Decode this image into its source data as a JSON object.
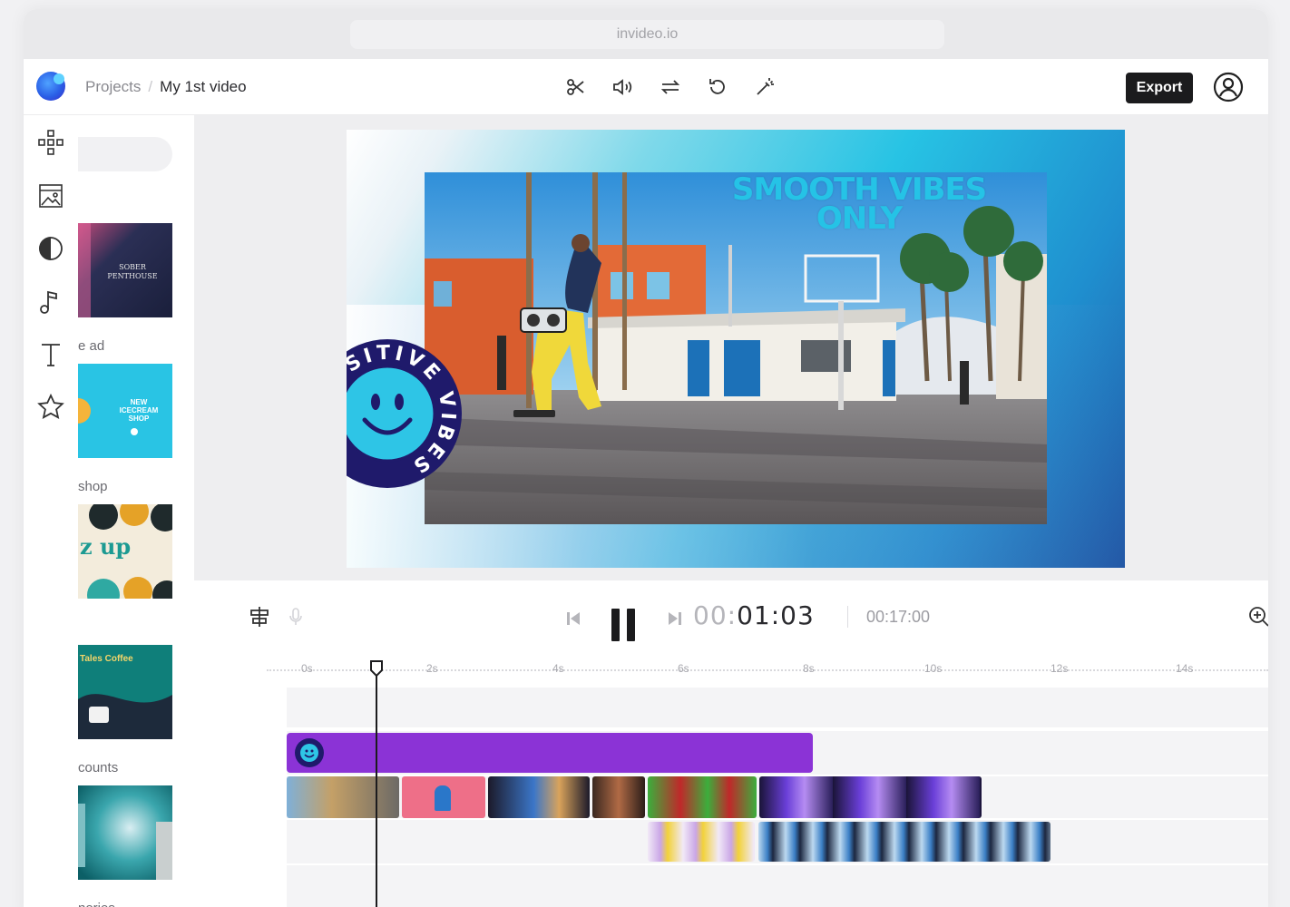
{
  "browser": {
    "url": "invideo.io"
  },
  "breadcrumb": {
    "projects": "Projects",
    "separator": "/",
    "current": "My 1st video"
  },
  "toolbar": {
    "icons": [
      "scissors-icon",
      "volume-icon",
      "swap-icon",
      "rotate-icon",
      "magic-wand-icon"
    ],
    "export_label": "Export"
  },
  "sidebar": {
    "icons": [
      "layout-icon",
      "media-icon",
      "stickers-icon",
      "music-icon",
      "text-icon",
      "star-icon"
    ]
  },
  "templates": [
    {
      "label": "e ad",
      "title": "SOBER PENTHOUSE"
    },
    {
      "label": "shop",
      "title": "NEW ICECREAM SHOP"
    },
    {
      "label": "",
      "title": "z up"
    },
    {
      "label": "counts",
      "title": "Tales Coffee"
    },
    {
      "label": "nories",
      "title": ""
    }
  ],
  "canvas": {
    "headline_line1": "SMOOTH VIBES",
    "headline_line2": "ONLY",
    "sticker_text": "POSITIVE VIBES"
  },
  "playback": {
    "current_dim": "00:",
    "current_main": "01:03",
    "duration": "00:17:00"
  },
  "ruler": {
    "ticks": [
      "0s",
      "2s",
      "4s",
      "6s",
      "8s",
      "10s",
      "12s",
      "14s"
    ]
  },
  "colors": {
    "accent": "#8b33d6",
    "export_bg": "#1b1b1d",
    "headline": "#25c3e6",
    "sticker_ring": "#1f1a6b",
    "sticker_face": "#2ec5e6"
  }
}
